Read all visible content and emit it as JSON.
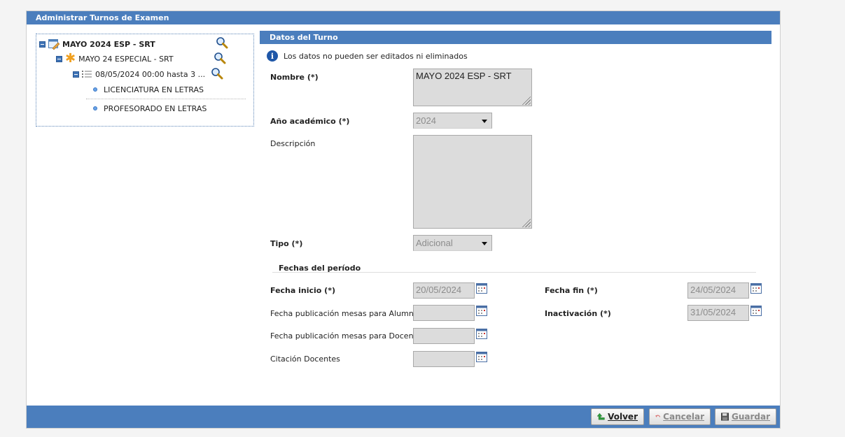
{
  "window": {
    "title": "Administrar Turnos de Examen"
  },
  "tree": {
    "root": {
      "label": "MAYO 2024 ESP - SRT"
    },
    "child": {
      "label": "MAYO 24 ESPECIAL - SRT"
    },
    "grandchild": {
      "label": "08/05/2024 00:00 hasta 3 ..."
    },
    "leaves": [
      "LICENCIATURA EN LETRAS",
      "PROFESORADO EN LETRAS"
    ]
  },
  "panel": {
    "title": "Datos del Turno",
    "info": "Los datos no pueden ser editados ni eliminados"
  },
  "form": {
    "nombre": {
      "label": "Nombre (*)",
      "value": "MAYO 2024 ESP - SRT"
    },
    "anio": {
      "label": "Año académico (*)",
      "value": "2024"
    },
    "descripcion": {
      "label": "Descripción",
      "value": ""
    },
    "tipo": {
      "label": "Tipo (*)",
      "value": "Adicional"
    },
    "fieldset_title": "Fechas del período",
    "fecha_inicio": {
      "label": "Fecha inicio (*)",
      "value": "20/05/2024"
    },
    "fecha_fin": {
      "label": "Fecha fin (*)",
      "value": "24/05/2024"
    },
    "pub_alumnos": {
      "label": "Fecha publicación mesas para Alumnos",
      "value": ""
    },
    "inactivacion": {
      "label": "Inactivación (*)",
      "value": "31/05/2024"
    },
    "pub_docentes": {
      "label": "Fecha publicación mesas para Docentes",
      "value": ""
    },
    "citacion": {
      "label": "Citación Docentes",
      "value": ""
    }
  },
  "footer": {
    "volver": "Volver",
    "cancelar": "Cancelar",
    "guardar": "Guardar"
  }
}
